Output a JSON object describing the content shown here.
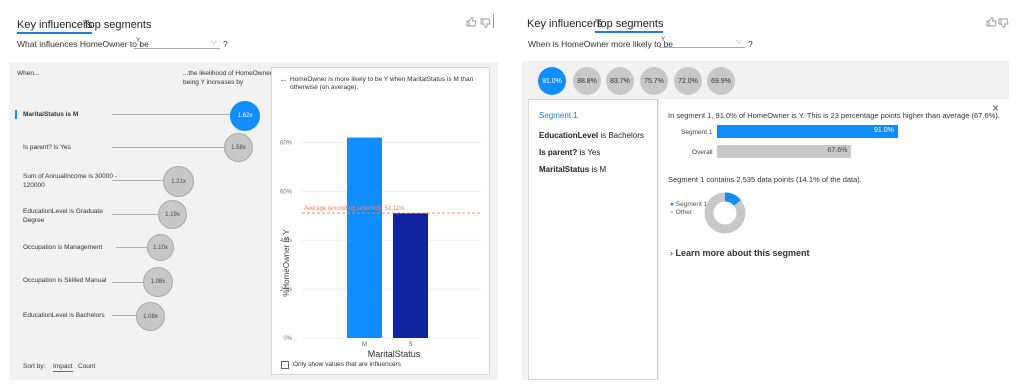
{
  "left": {
    "tabs": [
      "Key influencers",
      "Top segments"
    ],
    "question_prefix": "What influences HomeOwner to be",
    "dropdown_value": "Y",
    "question_suffix": "?",
    "col_when": "When...",
    "col_likelihood": "...the likelihood of HomeOwner being Y increases by",
    "influencers": [
      {
        "label": "MaritalStatus is M",
        "value": "1.62x"
      },
      {
        "label": "Is parent? is Yes",
        "value": "1.58x"
      },
      {
        "label": "Sum of AnnualIncome is 30000 - 120000",
        "value": "1.21x"
      },
      {
        "label": "EducationLevel is Graduate Degree",
        "value": "1.19x"
      },
      {
        "label": "Occupation is Management",
        "value": "1.10x"
      },
      {
        "label": "Occupation is Skilled Manual",
        "value": "1.08x"
      },
      {
        "label": "EducationLevel is Bachelors",
        "value": "1.08x"
      }
    ],
    "sort_by": "Sort by:",
    "sort_impact": "Impact",
    "sort_count": "Count",
    "detail_text": "HomeOwner is more likely to be Y when MaritalStatus is M than otherwise (on average).",
    "checkbox_label": "Only show values that are influencers"
  },
  "chart_data": {
    "type": "bar",
    "categories": [
      "M",
      "S"
    ],
    "values": [
      82,
      51
    ],
    "colors": [
      "#118dff",
      "#12239e"
    ],
    "xlabel": "MaritalStatus",
    "ylabel": "%HomeOwner is Y",
    "yticks": [
      "0%",
      "20%",
      "40%",
      "60%",
      "80%"
    ],
    "ylim": [
      0,
      90
    ],
    "average": 51.11,
    "average_label": "Average (excluding selected): 51.11%",
    "average_color": "#f0805a"
  },
  "right": {
    "tabs": [
      "Key influencers",
      "Top segments"
    ],
    "question_prefix": "When is HomeOwner more likely to be",
    "dropdown_value": "Y",
    "question_suffix": "?",
    "segments": [
      "91.0%",
      "88.8%",
      "83.7%",
      "75.7%",
      "72.0%",
      "69.9%"
    ],
    "segment_title": "Segment 1",
    "conditions": [
      {
        "bold": "EducationLevel",
        "rest": " is Bachelors"
      },
      {
        "bold": "Is parent?",
        "rest": " is Yes"
      },
      {
        "bold": "MaritalStatus",
        "rest": " is M"
      }
    ],
    "summary": "In segment 1, 91.0% of HomeOwner is Y. This is 23 percentage points higher than average (67.6%).",
    "bar_segment_label": "Segment 1",
    "bar_segment_value": "91.0%",
    "bar_segment_pct": 91.0,
    "bar_overall_label": "Overall",
    "bar_overall_value": "67.6%",
    "bar_overall_pct": 67.6,
    "contains_text": "Segment 1 contains 2,535 data points (14.1% of the data).",
    "legend_segment": "Segment 1",
    "legend_other": "Other",
    "donut_share": 14.1,
    "learn_more": "Learn more about this segment"
  }
}
